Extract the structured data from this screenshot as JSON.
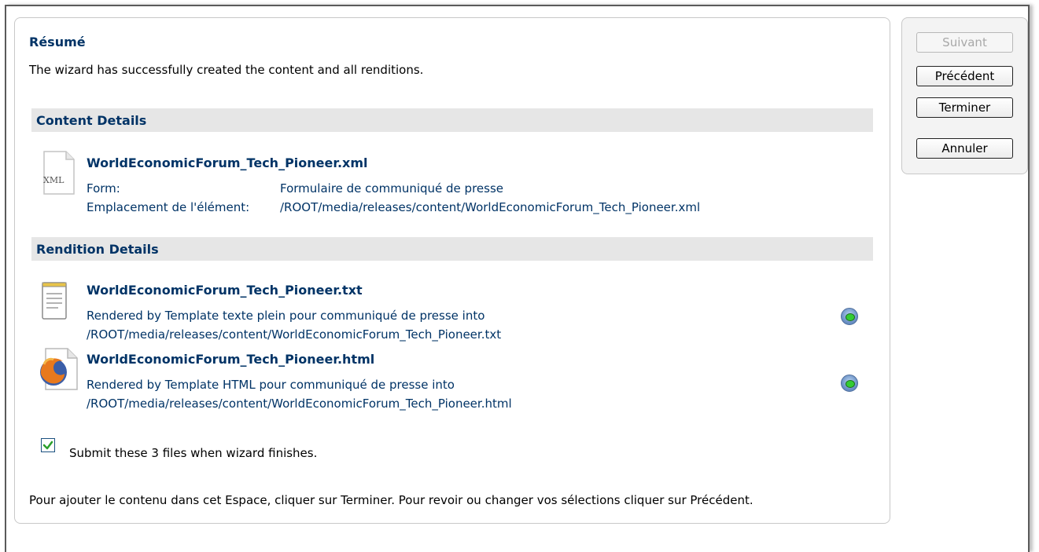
{
  "summary": {
    "title": "Résumé",
    "intro": "The wizard has successfully created the content and all renditions."
  },
  "content_details": {
    "heading": "Content Details",
    "icon": "xml-file-icon",
    "file_name": "WorldEconomicForum_Tech_Pioneer.xml",
    "form_label": "Form:",
    "form_value": "Formulaire de communiqué de presse",
    "location_label": "Emplacement de l'élément:",
    "location_value": "/ROOT/media/releases/content/WorldEconomicForum_Tech_Pioneer.xml"
  },
  "rendition_details": {
    "heading": "Rendition Details",
    "items": [
      {
        "icon": "text-file-icon",
        "file_name": "WorldEconomicForum_Tech_Pioneer.txt",
        "rendered_by": "Rendered by Template texte plein pour communiqué de presse into",
        "path": "/ROOT/media/releases/content/WorldEconomicForum_Tech_Pioneer.txt",
        "preview_icon": "preview-eye-icon"
      },
      {
        "icon": "html-file-icon",
        "file_name": "WorldEconomicForum_Tech_Pioneer.html",
        "rendered_by": "Rendered by Template HTML pour communiqué de presse into",
        "path": "/ROOT/media/releases/content/WorldEconomicForum_Tech_Pioneer.html",
        "preview_icon": "preview-eye-icon"
      }
    ]
  },
  "submit": {
    "checked": true,
    "label": "Submit these 3 files when wizard finishes."
  },
  "footer_note": "Pour ajouter le contenu dans cet Espace, cliquer sur Terminer. Pour revoir ou changer vos sélections cliquer sur Précédent.",
  "buttons": {
    "next": "Suivant",
    "previous": "Précédent",
    "finish": "Terminer",
    "cancel": "Annuler"
  },
  "colors": {
    "heading": "#003366",
    "section_background": "#e6e6e6",
    "checkbox_check": "#2ca02c"
  }
}
